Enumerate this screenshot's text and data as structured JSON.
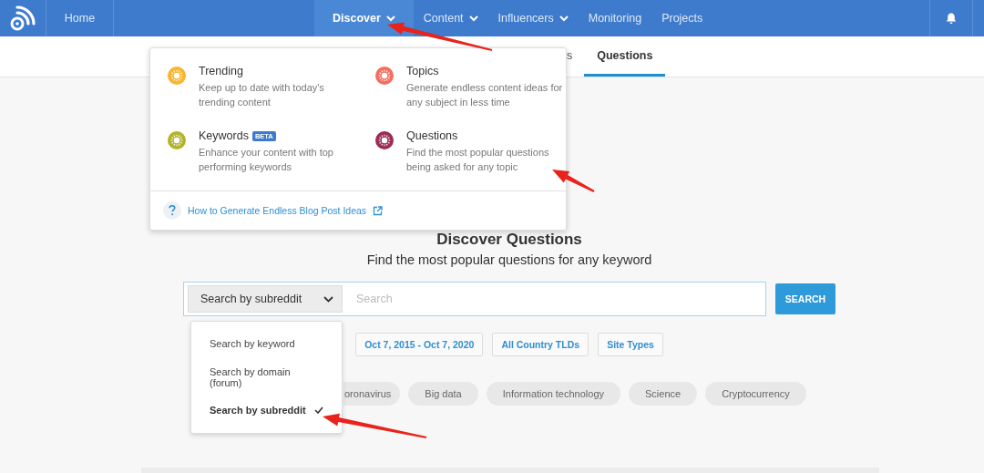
{
  "nav": {
    "items": [
      {
        "label": "Home",
        "dropdown": false,
        "selected": false
      },
      {
        "label": "Discover",
        "dropdown": true,
        "selected": true
      },
      {
        "label": "Content",
        "dropdown": true,
        "selected": false
      },
      {
        "label": "Influencers",
        "dropdown": true,
        "selected": false
      },
      {
        "label": "Monitoring",
        "dropdown": false,
        "selected": false
      },
      {
        "label": "Projects",
        "dropdown": false,
        "selected": false
      }
    ]
  },
  "subtabs": [
    {
      "label": "s",
      "selected": false
    },
    {
      "label": "Questions",
      "selected": true
    }
  ],
  "discover_menu": {
    "items": [
      {
        "title": "Trending",
        "description": "Keep up to date with today's trending content",
        "color": "#f9b52c"
      },
      {
        "title": "Topics",
        "description": "Generate endless content ideas for any subject in less time",
        "color": "#f56d5d"
      },
      {
        "title": "Keywords",
        "badge": "BETA",
        "description": "Enhance your content with top performing keywords",
        "color": "#b3b32b"
      },
      {
        "title": "Questions",
        "description": "Find the most popular questions being asked for any topic",
        "color": "#9c2a55"
      }
    ],
    "help_link": "How to Generate Endless Blog Post Ideas"
  },
  "heading": "Discover Questions",
  "subheading": "Find the most popular questions for any keyword",
  "search": {
    "mode": "Search by subreddit",
    "placeholder": "Search",
    "button": "SEARCH"
  },
  "mode_options": [
    {
      "label": "Search by keyword",
      "selected": false
    },
    {
      "label": "Search by domain (forum)",
      "selected": false
    },
    {
      "label": "Search by subreddit",
      "selected": true
    }
  ],
  "filters": [
    "Oct 7, 2015 - Oct 7, 2020",
    "All Country TLDs",
    "Site Types"
  ],
  "suggestions": [
    "oronavirus",
    "Big data",
    "Information technology",
    "Science",
    "Cryptocurrency"
  ]
}
